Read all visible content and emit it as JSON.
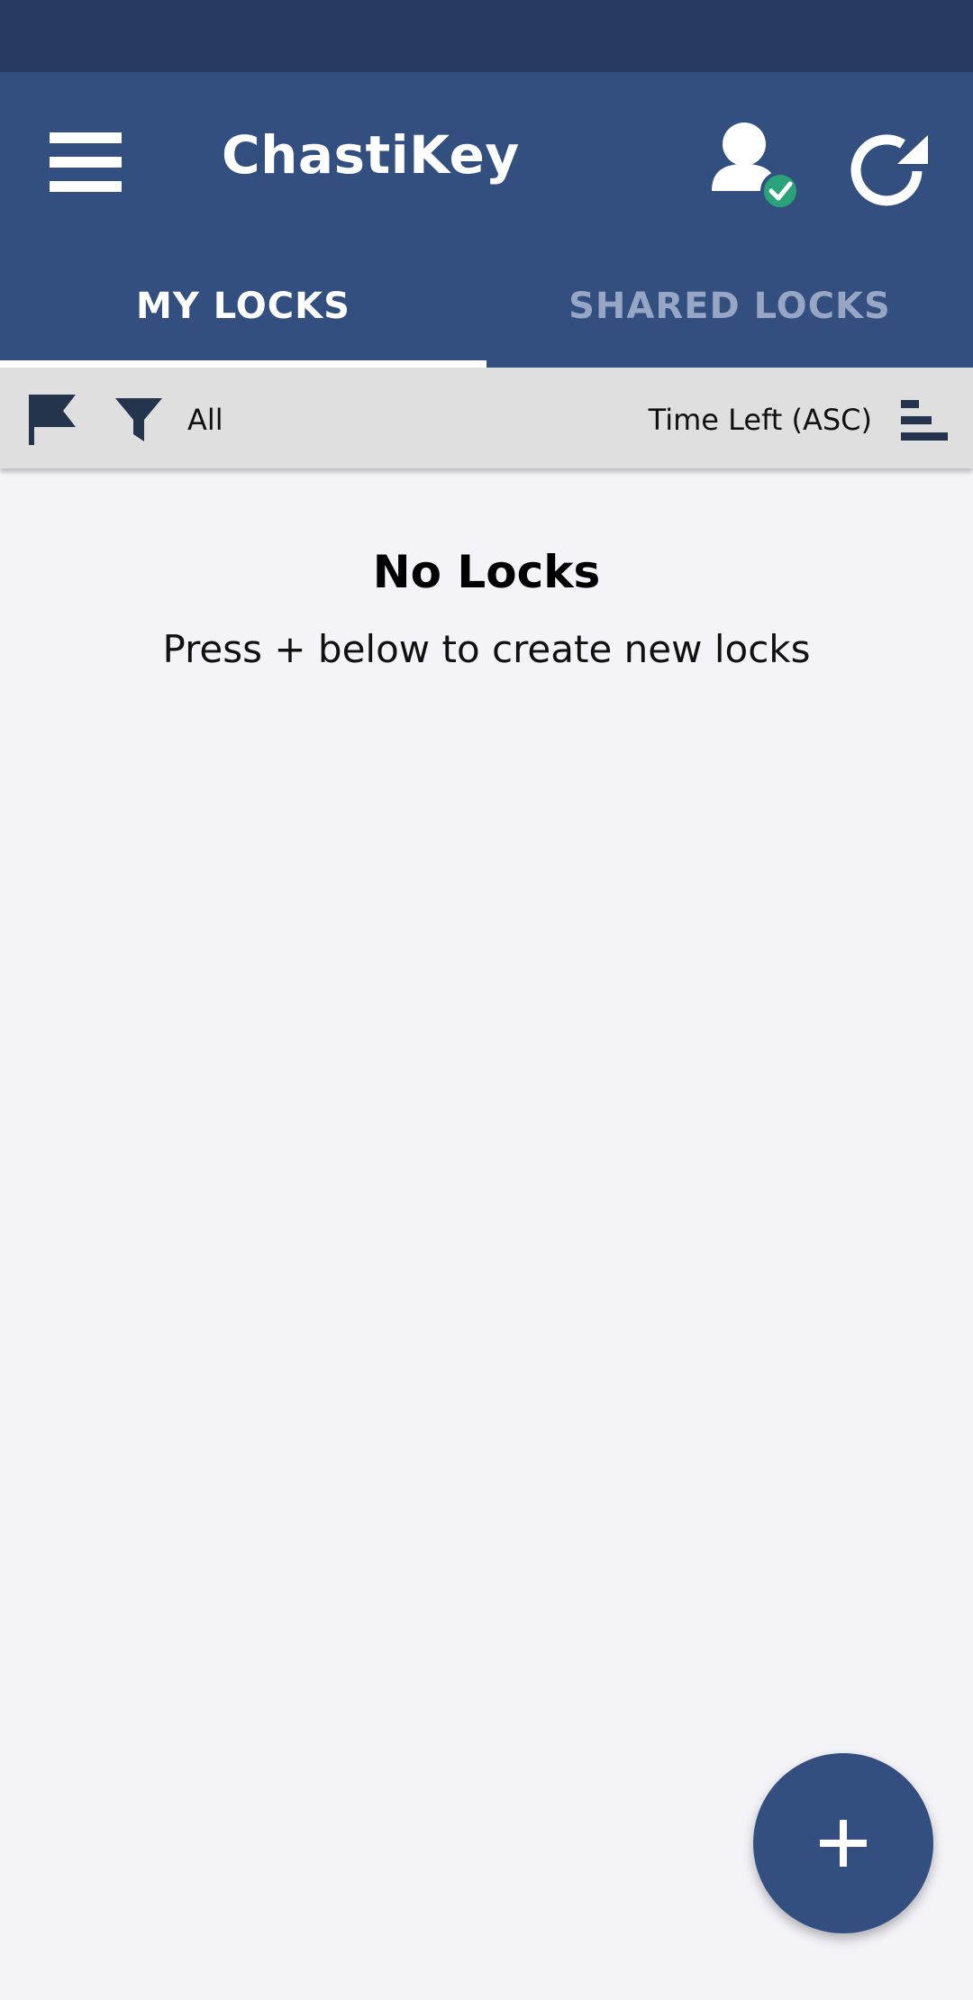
{
  "header": {
    "title": "ChastiKey",
    "menu_icon": "hamburger-menu-icon",
    "account_icon": "user-verified-icon",
    "refresh_icon": "refresh-icon"
  },
  "tabs": [
    {
      "label": "MY LOCKS",
      "active": true
    },
    {
      "label": "SHARED LOCKS",
      "active": false
    }
  ],
  "toolbar": {
    "flag_icon": "flag-icon",
    "filter_icon": "filter-icon",
    "filter_value": "All",
    "sort_value": "Time Left (ASC)",
    "sort_icon": "sort-icon"
  },
  "empty_state": {
    "title": "No Locks",
    "subtitle": "Press + below to create new locks"
  },
  "fab": {
    "icon": "plus-icon"
  },
  "colors": {
    "status_bar": "#253961",
    "primary": "#334f80",
    "tab_inactive": "#96a6c4",
    "toolbar_bg": "#dfdfdf",
    "icon_dark": "#24344d",
    "verified_badge": "#2aa37a",
    "background": "#f3f3f8"
  }
}
